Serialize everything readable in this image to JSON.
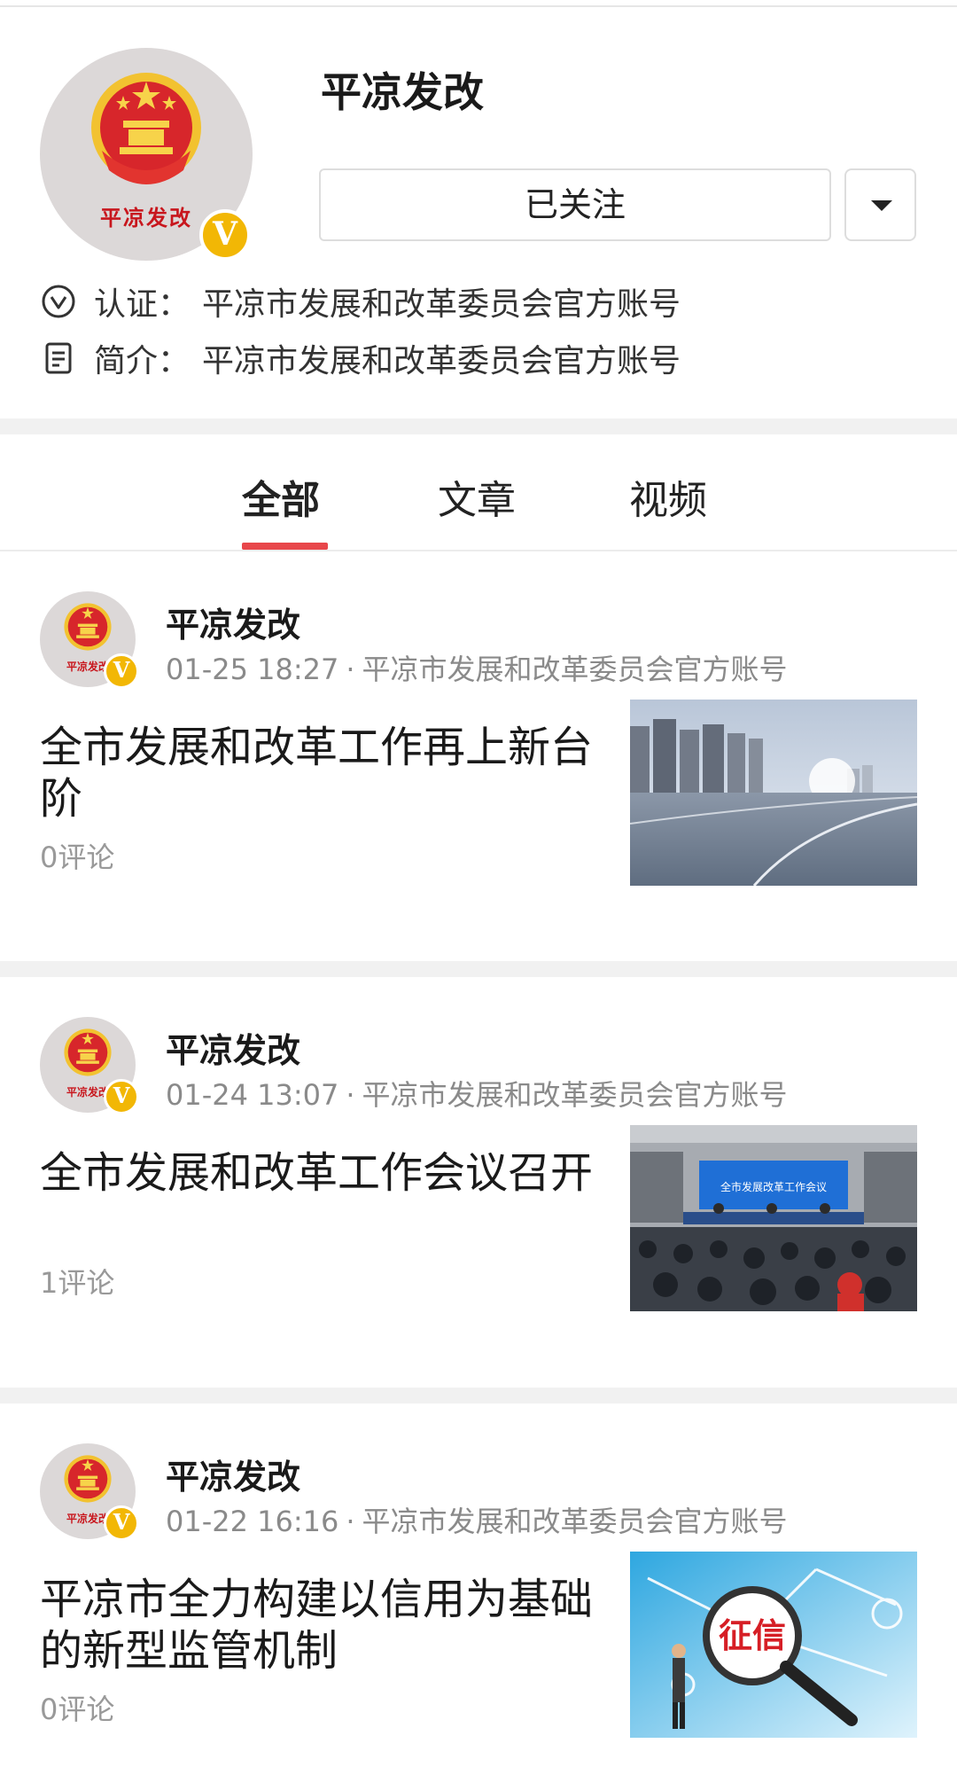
{
  "profile": {
    "name": "平凉发改",
    "avatar_caption": "平凉发改",
    "verified_badge": "V",
    "follow_button": "已关注",
    "cert_label": "认证：",
    "cert_text": "平凉市发展和改革委员会官方账号",
    "intro_label": "简介：",
    "intro_text": "平凉市发展和改革委员会官方账号"
  },
  "tabs": [
    {
      "label": "全部",
      "active": true
    },
    {
      "label": "文章",
      "active": false
    },
    {
      "label": "视频",
      "active": false
    }
  ],
  "feed": [
    {
      "author": "平凉发改",
      "avatar_caption": "平凉发改",
      "time": "01-25 18:27",
      "separator": "·",
      "source": "平凉市发展和改革委员会官方账号",
      "title": "全市发展和改革工作再上新台阶",
      "comments": "0评论",
      "thumb_icon": "city-road-photo"
    },
    {
      "author": "平凉发改",
      "avatar_caption": "平凉发改",
      "time": "01-24 13:07",
      "separator": "·",
      "source": "平凉市发展和改革委员会官方账号",
      "title": "全市发展和改革工作会议召开",
      "comments": "1评论",
      "thumb_icon": "meeting-room-photo",
      "thumb_banner": "全市发展改革工作会议"
    },
    {
      "author": "平凉发改",
      "avatar_caption": "平凉发改",
      "time": "01-22 16:16",
      "separator": "·",
      "source": "平凉市发展和改革委员会官方账号",
      "title": "平凉市全力构建以信用为基础的新型监管机制",
      "comments": "0评论",
      "thumb_icon": "credit-magnifier-photo",
      "thumb_text": "征信"
    }
  ],
  "colors": {
    "accent": "#e8464a",
    "badge": "#f2b705",
    "emblem_red": "#c8161d",
    "emblem_gold": "#f2c230"
  }
}
